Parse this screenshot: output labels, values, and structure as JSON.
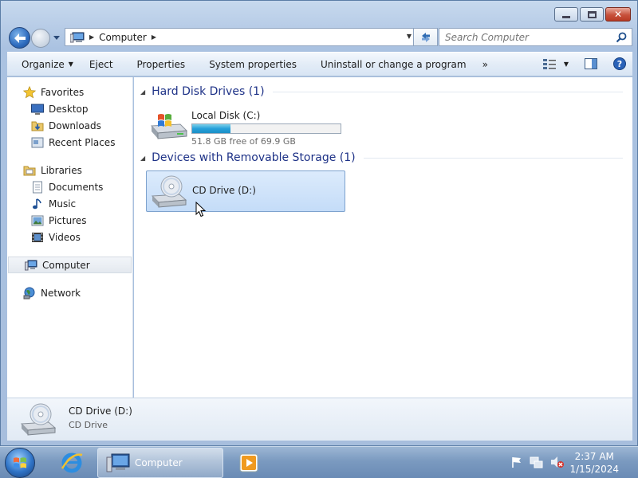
{
  "window": {
    "caption_buttons": [
      "minimize",
      "maximize",
      "close"
    ],
    "close_symbol": "✕"
  },
  "address_bar": {
    "crumbs": [
      "Computer"
    ],
    "search_placeholder": "Search Computer"
  },
  "toolbar": {
    "organize": "Organize",
    "eject": "Eject",
    "properties": "Properties",
    "system_properties": "System properties",
    "uninstall": "Uninstall or change a program",
    "more": "»"
  },
  "nav": {
    "favorites": "Favorites",
    "desktop": "Desktop",
    "downloads": "Downloads",
    "recent_places": "Recent Places",
    "libraries": "Libraries",
    "documents": "Documents",
    "music": "Music",
    "pictures": "Pictures",
    "videos": "Videos",
    "computer": "Computer",
    "network": "Network"
  },
  "content": {
    "hard_disk_header": "Hard Disk Drives (1)",
    "local_disk": {
      "name": "Local Disk (C:)",
      "free_text": "51.8 GB free of 69.9 GB",
      "used_fraction": 0.26
    },
    "removable_header": "Devices with Removable Storage (1)",
    "cd_drive": {
      "name": "CD Drive (D:)"
    }
  },
  "details": {
    "name": "CD Drive (D:)",
    "type": "CD Drive"
  },
  "taskbar": {
    "explorer_label": "Computer",
    "time": "2:37 AM",
    "date": "1/15/2024"
  },
  "colors": {
    "accent": "#1e3287",
    "selection": "#c4dcf8",
    "progress": "#26a0da"
  }
}
